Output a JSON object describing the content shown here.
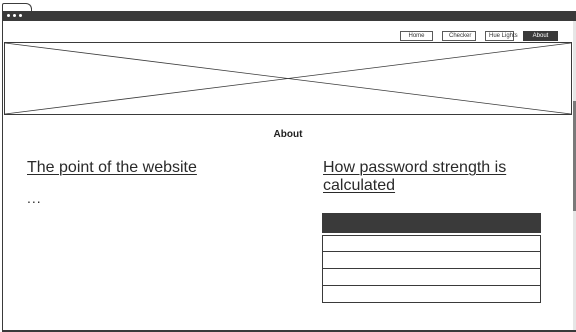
{
  "nav": {
    "items": [
      {
        "label": "Home",
        "active": false
      },
      {
        "label": "Checker",
        "active": false
      },
      {
        "label": "Hue Lights",
        "active": false
      },
      {
        "label": "About",
        "active": true
      }
    ]
  },
  "page": {
    "title": "About"
  },
  "left_column": {
    "heading": "The point of the website",
    "body": "..."
  },
  "right_column": {
    "heading": "How password strength is calculated",
    "table": {
      "header": "",
      "rows": [
        "",
        "",
        "",
        ""
      ]
    }
  },
  "colors": {
    "dark": "#3a3a3a",
    "background": "#ffffff"
  }
}
